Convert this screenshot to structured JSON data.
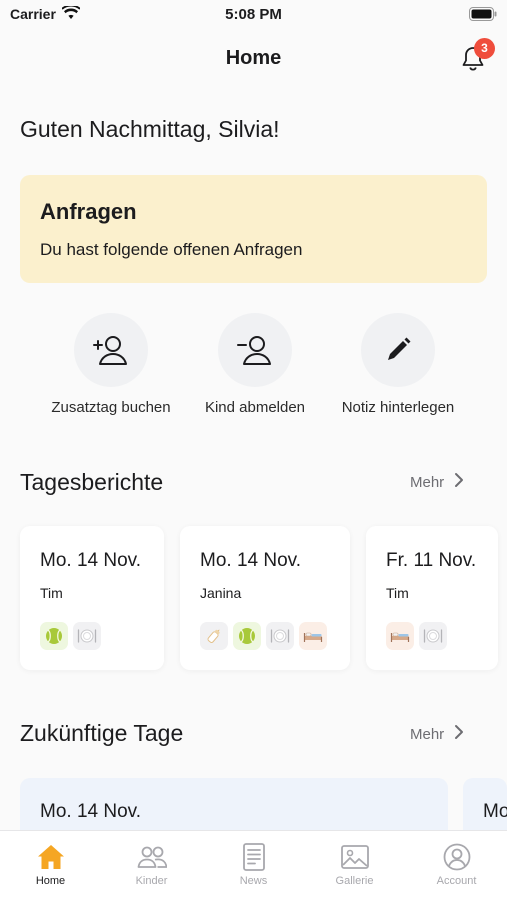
{
  "status_bar": {
    "carrier": "Carrier",
    "time": "5:08 PM"
  },
  "header": {
    "title": "Home",
    "notification_count": "3"
  },
  "greeting": "Guten Nachmittag, Silvia!",
  "requests": {
    "title": "Anfragen",
    "subtitle": "Du hast folgende offenen Anfragen"
  },
  "actions": [
    {
      "label": "Zusatztag buchen",
      "icon": "user-plus-icon"
    },
    {
      "label": "Kind abmelden",
      "icon": "user-minus-icon"
    },
    {
      "label": "Notiz hinterlegen",
      "icon": "pencil-icon"
    }
  ],
  "daily_reports": {
    "title": "Tagesberichte",
    "more_label": "Mehr",
    "cards": [
      {
        "date": "Mo. 14 Nov.",
        "name": "Tim",
        "icons": [
          "tennis-ball-icon",
          "plate-cutlery-icon"
        ]
      },
      {
        "date": "Mo. 14 Nov.",
        "name": "Janina",
        "icons": [
          "baby-bottle-icon",
          "tennis-ball-icon",
          "plate-cutlery-icon",
          "bed-icon"
        ]
      },
      {
        "date": "Fr. 11 Nov.",
        "name": "Tim",
        "icons": [
          "bed-icon",
          "plate-cutlery-icon"
        ]
      }
    ]
  },
  "future_days": {
    "title": "Zukünftige Tage",
    "more_label": "Mehr",
    "cards": [
      {
        "date": "Mo. 14 Nov."
      },
      {
        "date": "Mo"
      }
    ]
  },
  "tab_bar": {
    "tabs": [
      {
        "label": "Home",
        "icon": "home-icon",
        "active": true
      },
      {
        "label": "Kinder",
        "icon": "users-icon",
        "active": false
      },
      {
        "label": "News",
        "icon": "document-icon",
        "active": false
      },
      {
        "label": "Gallerie",
        "icon": "image-icon",
        "active": false
      },
      {
        "label": "Account",
        "icon": "account-icon",
        "active": false
      }
    ]
  },
  "colors": {
    "accent": "#f5a623",
    "badge": "#ef4d3c",
    "requests_bg": "#fbf0cd",
    "future_card_bg": "#eef3fb"
  }
}
